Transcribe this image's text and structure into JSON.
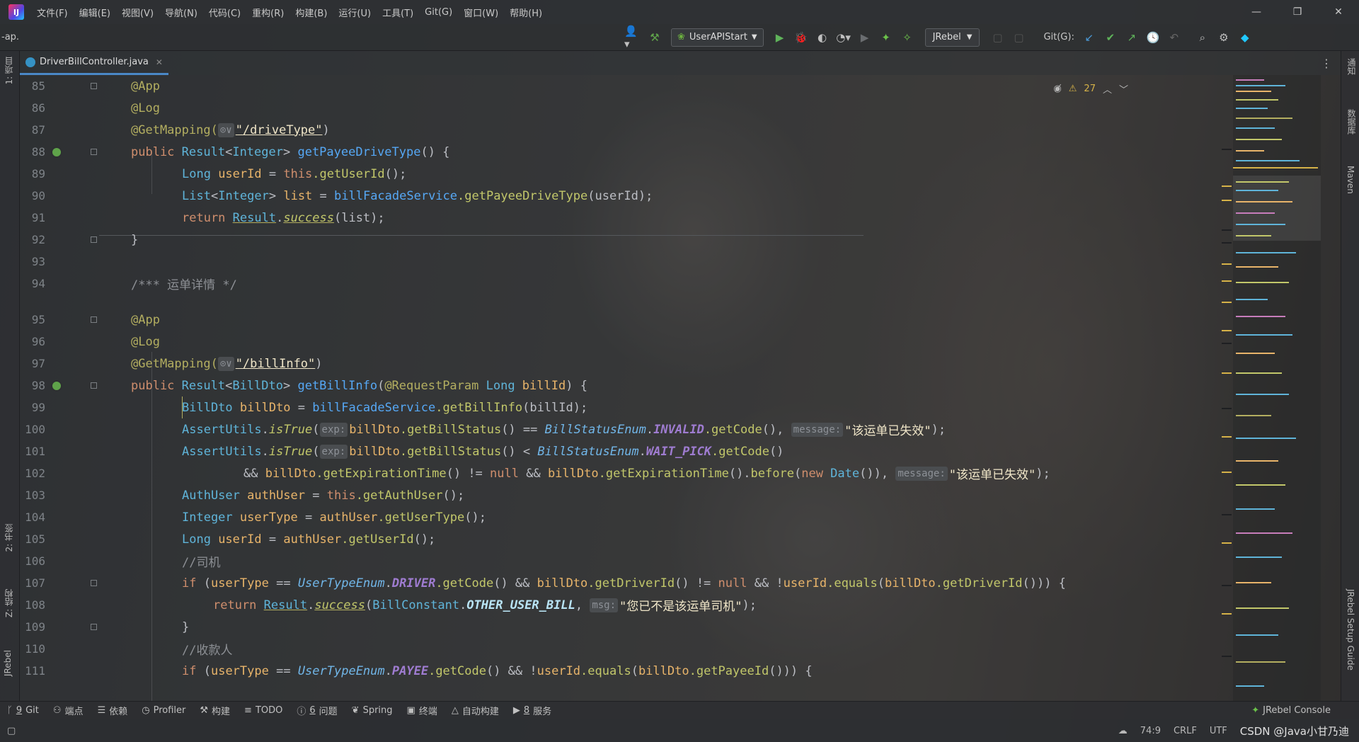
{
  "menu": {
    "items": [
      "文件(F)",
      "编辑(E)",
      "视图(V)",
      "导航(N)",
      "代码(C)",
      "重构(R)",
      "构建(B)",
      "运行(U)",
      "工具(T)",
      "Git(G)",
      "窗口(W)",
      "帮助(H)"
    ]
  },
  "toolbar": {
    "project": "-ap.",
    "run_config": "UserAPIStart",
    "jrebel": "JRebel",
    "git_label": "Git(G):"
  },
  "tabs": [
    {
      "label": "DriverBillController.java"
    }
  ],
  "inspections": {
    "warnings": "27"
  },
  "side_tabs_left": [
    "1: 项目",
    "2: 书签",
    "Z: 结构",
    "JRebel"
  ],
  "side_tabs_right": [
    "通知",
    "数据库",
    "Maven",
    "JRebel Setup Guide"
  ],
  "editor": {
    "line_numbers": [
      "85",
      "86",
      "87",
      "88",
      "89",
      "90",
      "91",
      "92",
      "93",
      "94",
      "95",
      "96",
      "97",
      "98",
      "99",
      "100",
      "101",
      "102",
      "103",
      "104",
      "105",
      "106",
      "107",
      "108",
      "109",
      "110",
      "111"
    ],
    "code": {
      "l85": "@App",
      "l86": "@Log",
      "l87_a": "@GetMapping(",
      "l87_hint": "⊙∨",
      "l87_s": "\"/driveType\"",
      "l87_b": ")",
      "l88_pub": "public ",
      "l88_type": "Result",
      "l88_lt": "<",
      "l88_int": "Integer",
      "l88_gt": "> ",
      "l88_m": "getPayeeDriveType",
      "l88_rest": "() {",
      "l89_t": "Long ",
      "l89_v": "userId",
      "l89_eq": " = ",
      "l89_this": "this",
      "l89_call": ".getUserId",
      "l89_end": "();",
      "l90_t": "List",
      "l90_lt": "<",
      "l90_int": "Integer",
      "l90_gt": "> ",
      "l90_v": "list",
      "l90_eq": " = ",
      "l90_svc": "billFacadeService",
      "l90_call": ".getPayeeDriveType",
      "l90_arg": "(userId);",
      "l91_ret": "return ",
      "l91_r": "Result",
      "l91_dot": ".",
      "l91_s": "success",
      "l91_arg": "(list);",
      "l92": "}",
      "l94": "/*** 运单详情 */",
      "l95": "@App",
      "l96": "@Log",
      "l97_a": "@GetMapping(",
      "l97_hint": "⊙∨",
      "l97_s": "\"/billInfo\"",
      "l97_b": ")",
      "l98_pub": "public ",
      "l98_type": "Result",
      "l98_lt": "<",
      "l98_dto": "BillDto",
      "l98_gt": "> ",
      "l98_m": "getBillInfo",
      "l98_p": "(",
      "l98_ann": "@RequestParam ",
      "l98_long": "Long ",
      "l98_v": "billId",
      "l98_end": ") {",
      "l99_t": "BillDto ",
      "l99_v": "billDto",
      "l99_eq": " = ",
      "l99_svc": "billFacadeService",
      "l99_call": ".getBillInfo",
      "l99_arg": "(billId);",
      "l100_cls": "AssertUtils",
      "l100_dot": ".",
      "l100_m": "isTrue",
      "l100_p": "(",
      "l100_hint": "exp:",
      "l100_v": "billDto",
      "l100_c": ".getBillStatus",
      "l100_eq": "() == ",
      "l100_enum": "BillStatusEnum",
      "l100_dot2": ".",
      "l100_ev": "INVALID",
      "l100_gc": ".getCode",
      "l100_comma": "(), ",
      "l100_hint2": "message:",
      "l100_s": "\"该运单已失效\"",
      "l100_end": ");",
      "l101_cls": "AssertUtils",
      "l101_dot": ".",
      "l101_m": "isTrue",
      "l101_p": "(",
      "l101_hint": "exp:",
      "l101_v": "billDto",
      "l101_c": ".getBillStatus",
      "l101_lt": "() < ",
      "l101_enum": "BillStatusEnum",
      "l101_dot2": ".",
      "l101_ev": "WAIT_PICK",
      "l101_gc": ".getCode",
      "l101_end": "()",
      "l102_and": "&& ",
      "l102_v": "billDto",
      "l102_c": ".getExpirationTime",
      "l102_ne": "() != ",
      "l102_null": "null",
      "l102_and2": " && ",
      "l102_v2": "billDto",
      "l102_c2": ".getExpirationTime",
      "l102_b": "().",
      "l102_before": "before",
      "l102_p": "(",
      "l102_new": "new ",
      "l102_date": "Date",
      "l102_pp": "()), ",
      "l102_hint": "message:",
      "l102_s": "\"该运单已失效\"",
      "l102_end": ");",
      "l103_t": "AuthUser ",
      "l103_v": "authUser",
      "l103_eq": " = ",
      "l103_this": "this",
      "l103_call": ".getAuthUser",
      "l103_end": "();",
      "l104_t": "Integer ",
      "l104_v": "userType",
      "l104_eq": " = ",
      "l104_v2": "authUser",
      "l104_call": ".getUserType",
      "l104_end": "();",
      "l105_t": "Long ",
      "l105_v": "userId",
      "l105_eq": " = ",
      "l105_v2": "authUser",
      "l105_call": ".getUserId",
      "l105_end": "();",
      "l106": "//司机",
      "l107_if": "if ",
      "l107_p": "(",
      "l107_v": "userType",
      "l107_eq": " == ",
      "l107_enum": "UserTypeEnum",
      "l107_dot": ".",
      "l107_ev": "DRIVER",
      "l107_gc": ".getCode",
      "l107_and": "() && ",
      "l107_v2": "billDto",
      "l107_c": ".getDriverId",
      "l107_ne": "() != ",
      "l107_null": "null",
      "l107_and2": " && !",
      "l107_v3": "userId",
      "l107_eqs": ".equals",
      "l107_p2": "(",
      "l107_v4": "billDto",
      "l107_c2": ".getDriverId",
      "l107_end": "())) {",
      "l108_ret": "return ",
      "l108_r": "Result",
      "l108_dot": ".",
      "l108_s": "success",
      "l108_p": "(",
      "l108_bc": "BillConstant",
      "l108_dot2": ".",
      "l108_cv": "OTHER_USER_BILL",
      "l108_comma": ", ",
      "l108_hint": "msg:",
      "l108_str": "\"您已不是该运单司机\"",
      "l108_end": ");",
      "l109": "}",
      "l110": "//收款人",
      "l111_if": "if ",
      "l111_p": "(",
      "l111_v": "userType",
      "l111_eq": " == ",
      "l111_enum": "UserTypeEnum",
      "l111_dot": ".",
      "l111_ev": "PAYEE",
      "l111_gc": ".getCode",
      "l111_and": "() && !",
      "l111_v2": "userId",
      "l111_eqs": ".equals",
      "l111_p2": "(",
      "l111_v3": "billDto",
      "l111_c": ".getPayeeId",
      "l111_end": "())) {"
    }
  },
  "bottom_tools": [
    {
      "key": "9",
      "label": "Git"
    },
    {
      "key": "",
      "label": "端点"
    },
    {
      "key": "",
      "label": "依赖"
    },
    {
      "key": "",
      "label": "Profiler"
    },
    {
      "key": "",
      "label": "构建"
    },
    {
      "key": "",
      "label": "TODO"
    },
    {
      "key": "6",
      "label": "问题"
    },
    {
      "key": "",
      "label": "Spring"
    },
    {
      "key": "",
      "label": "终端"
    },
    {
      "key": "",
      "label": "自动构建"
    },
    {
      "key": "8",
      "label": "服务"
    }
  ],
  "jrebel_console": "JRebel Console",
  "status": {
    "position": "74:9",
    "line_sep": "CRLF",
    "encoding": "UTF",
    "watermark": "CSDN @Java小甘乃迪"
  }
}
